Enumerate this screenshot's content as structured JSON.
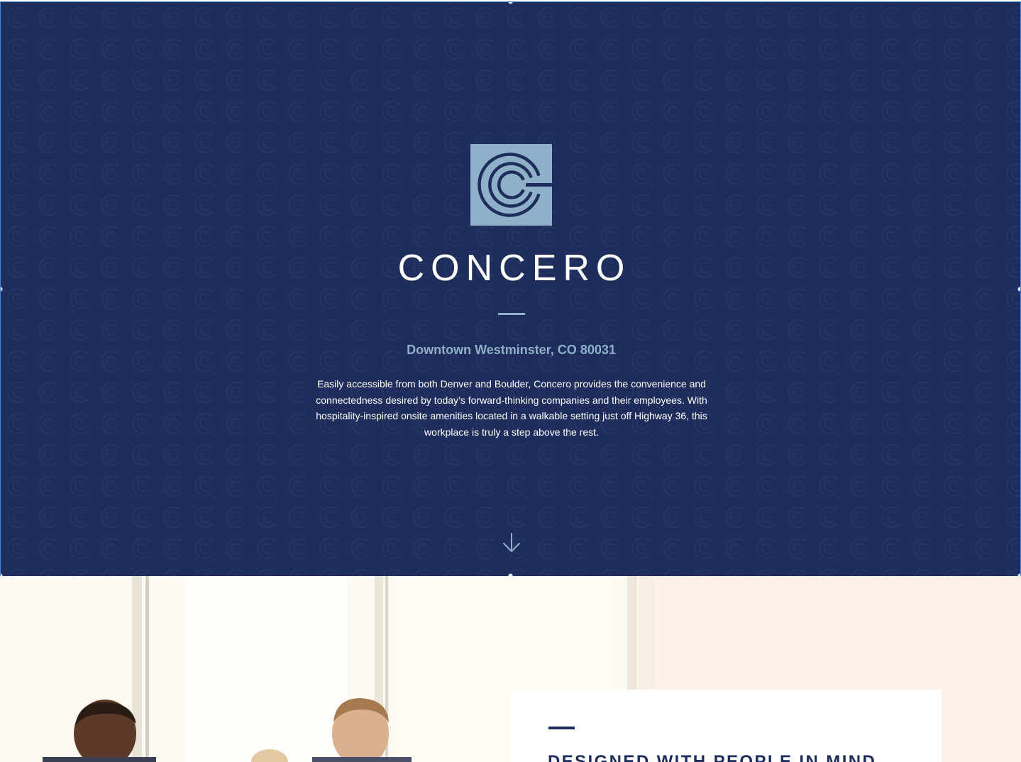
{
  "hero": {
    "brand_name": "CONCERO",
    "location": "Downtown Westminster, CO 80031",
    "description": "Easily accessible from both Denver and Boulder, Concero provides the convenience and connectedness desired by today’s forward-thinking companies and their employees. With hospitality-inspired onsite amenities located in a walkable setting just off Highway 36, this workplace is truly a step above the rest.",
    "logo_icon": "concero-c-logo-icon",
    "scroll_icon": "arrow-down-icon"
  },
  "feature": {
    "heading": "DESIGNED WITH PEOPLE IN MIND"
  },
  "colors": {
    "hero_background": "#1f2d5c",
    "accent_light_blue": "#8eb0c8",
    "selection_outline": "#4a86d6",
    "lower_background": "#fbf1e6"
  }
}
